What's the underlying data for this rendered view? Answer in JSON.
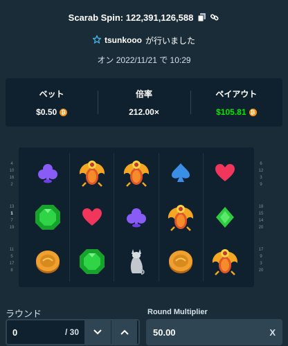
{
  "header": {
    "title": "Scarab Spin: 122,391,126,588",
    "username": "tsunkooo",
    "played_suffix": "が行いました",
    "date": "オン 2022/11/21 で 10:29"
  },
  "stats": {
    "bet_label": "ベット",
    "bet_value": "$0.50",
    "multiplier_label": "倍率",
    "multiplier_value": "212.00×",
    "payout_label": "ペイアウト",
    "payout_value": "$105.81",
    "currency_symbol": "₿"
  },
  "ruler_left": [
    [
      "4",
      "10",
      "16",
      "2"
    ],
    [
      "13",
      "1",
      "7",
      "19"
    ],
    [
      "11",
      "5",
      "17",
      "8"
    ]
  ],
  "ruler_right": [
    [
      "6",
      "12",
      "3",
      "9"
    ],
    [
      "18",
      "15",
      "14",
      "20"
    ],
    [
      "17",
      "9",
      "3",
      "20"
    ]
  ],
  "reels": [
    [
      "club",
      "gem",
      "coin"
    ],
    [
      "scarab",
      "heart",
      "gem"
    ],
    [
      "scarab",
      "club",
      "cat-statue"
    ],
    [
      "spade",
      "scarab",
      "coin"
    ],
    [
      "heart",
      "diamond",
      "scarab"
    ]
  ],
  "controls": {
    "round_label": "ラウンド",
    "round_value": "0",
    "round_total": "/ 30",
    "multiplier_label": "Round Multiplier",
    "multiplier_value": "50.00",
    "clear_label": "X"
  },
  "colors": {
    "background": "#1a2c38",
    "panel": "#0f212e",
    "input": "#2f4553",
    "payout_green": "#00e701",
    "coin_orange": "#f7931a"
  }
}
